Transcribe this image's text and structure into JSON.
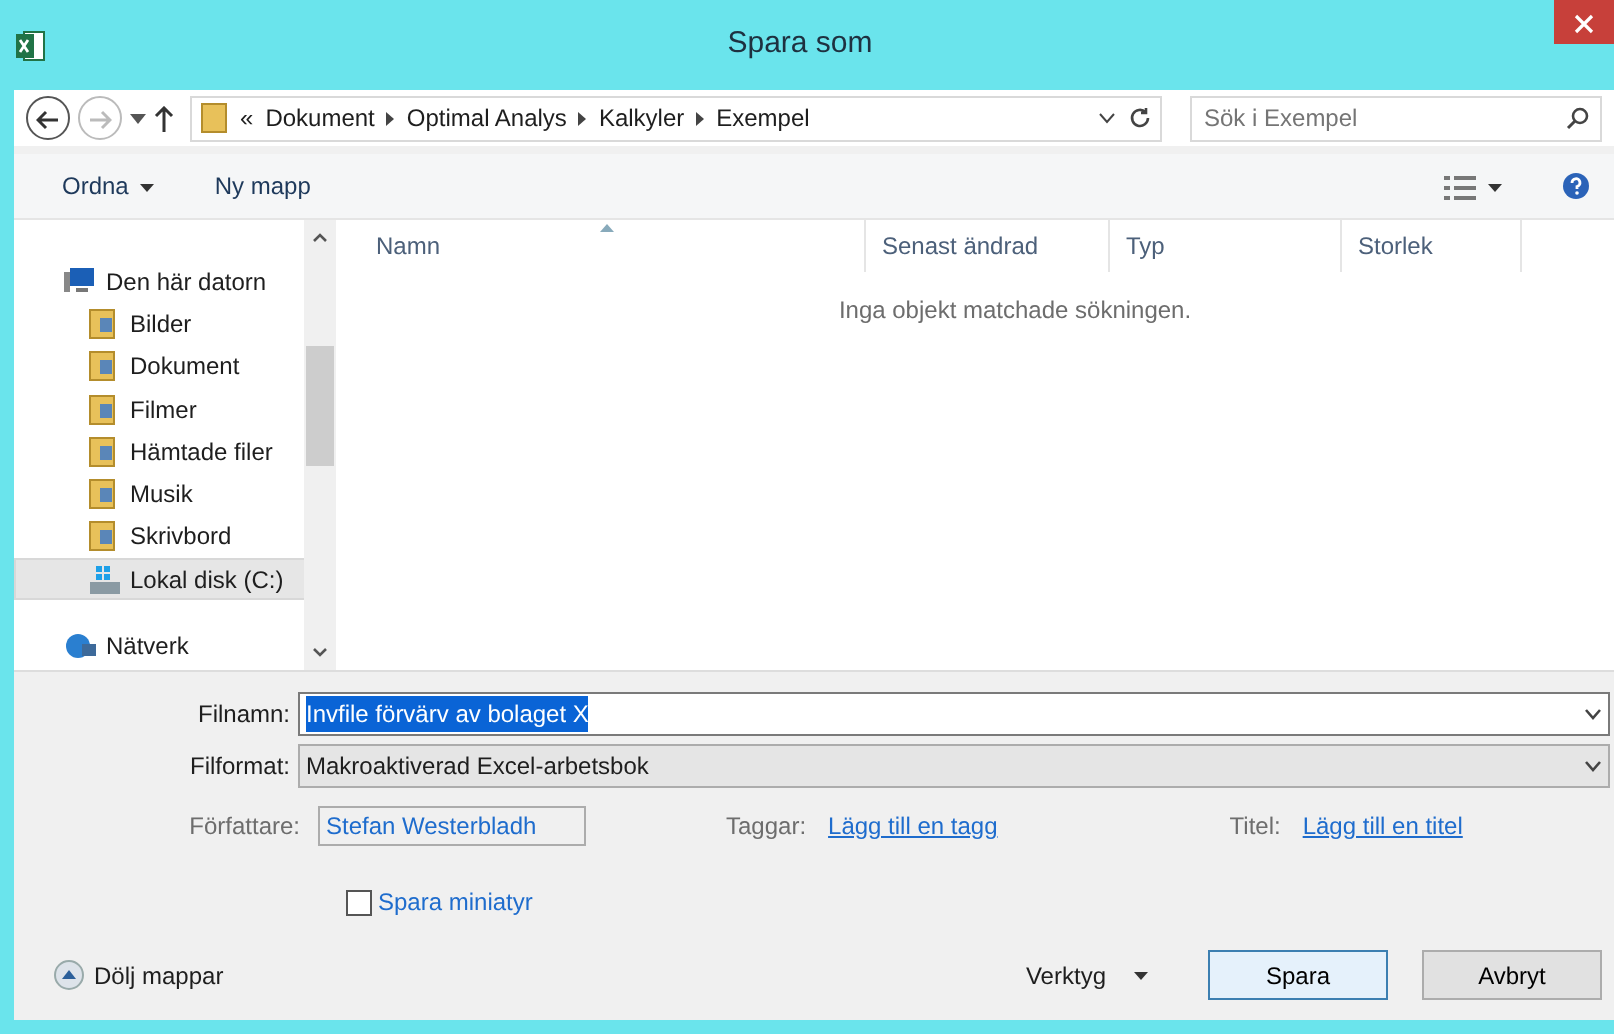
{
  "window": {
    "title": "Spara som"
  },
  "nav": {
    "buttons": [
      {
        "kind": "back",
        "disabled": false
      },
      {
        "kind": "forward",
        "disabled": true
      }
    ],
    "breadcrumbs": [
      "«",
      "Dokument",
      "Optimal Analys",
      "Kalkyler",
      "Exempel"
    ],
    "search": {
      "placeholder": "Sök i Exempel"
    }
  },
  "toolbar": {
    "organize": "Ordna",
    "new_folder": "Ny mapp"
  },
  "sidebar": {
    "items": [
      {
        "label": "Den här datorn",
        "kind": "computer",
        "selected": false,
        "children": [
          {
            "label": "Bilder",
            "kind": "folder",
            "selected": false
          },
          {
            "label": "Dokument",
            "kind": "folder",
            "selected": false
          },
          {
            "label": "Filmer",
            "kind": "folder",
            "selected": false
          },
          {
            "label": "Hämtade filer",
            "kind": "folder",
            "selected": false
          },
          {
            "label": "Musik",
            "kind": "folder",
            "selected": false
          },
          {
            "label": "Skrivbord",
            "kind": "folder",
            "selected": false
          },
          {
            "label": "Lokal disk (C:)",
            "kind": "disk",
            "selected": true
          }
        ]
      },
      {
        "label": "Nätverk",
        "kind": "network",
        "selected": false
      }
    ]
  },
  "table": {
    "columns": [
      {
        "label": "Namn",
        "sorted": true
      },
      {
        "label": "Senast ändrad",
        "sorted": false
      },
      {
        "label": "Typ",
        "sorted": false
      },
      {
        "label": "Storlek",
        "sorted": false
      }
    ],
    "empty_message": "Inga objekt matchade sökningen."
  },
  "form": {
    "filename": {
      "label": "Filnamn:",
      "value": "Invfile förvärv av bolaget X"
    },
    "format": {
      "label": "Filformat:",
      "value": "Makroaktiverad Excel-arbetsbok"
    },
    "author": {
      "label": "Författare:",
      "value": "Stefan Westerbladh"
    },
    "tags": {
      "label": "Taggar:",
      "link": "Lägg till en tagg"
    },
    "title": {
      "label": "Titel:",
      "link": "Lägg till en titel"
    },
    "thumbnail": {
      "label": "Spara miniatyr",
      "checked": false
    }
  },
  "footer": {
    "hide_folders": "Dölj mappar",
    "tools": "Verktyg",
    "buttons": [
      {
        "label": "Spara",
        "default": true
      },
      {
        "label": "Avbryt",
        "default": false
      }
    ]
  }
}
